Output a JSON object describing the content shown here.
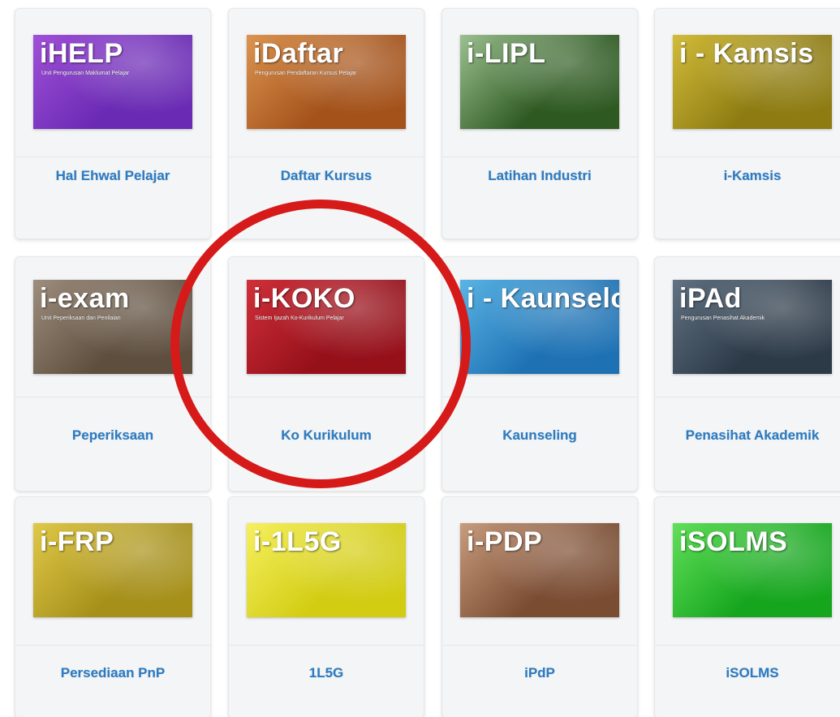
{
  "tiles": [
    {
      "label": "Hal Ehwal Pelajar",
      "image_title": "iHELP",
      "image_subtitle": "Unit Pengurusan Maklumat Pelajar",
      "color": "#6a2ab4",
      "color2": "#a050d8",
      "icon": "ihelp-logo-icon"
    },
    {
      "label": "Daftar Kursus",
      "image_title": "iDaftar",
      "image_subtitle": "Pengurusan Pendaftaran Kursus Pelajar",
      "color": "#a4521a",
      "color2": "#dc9450",
      "icon": "idaftar-logo-icon"
    },
    {
      "label": "Latihan Industri",
      "image_title": "i-LIPL",
      "image_subtitle": "",
      "color": "#2e5a22",
      "color2": "#9cc090",
      "icon": "ilipl-logo-icon"
    },
    {
      "label": "i-Kamsis",
      "image_title": "i - Kamsis",
      "image_subtitle": "",
      "color": "#8e7c12",
      "color2": "#d2bc3a",
      "icon": "ikamsis-logo-icon"
    },
    {
      "label": "Peperiksaan",
      "image_title": "i-exam",
      "image_subtitle": "Unit Peperiksaan dan Penilaian",
      "color": "#5e4e3e",
      "color2": "#9e8e7e",
      "icon": "iexam-logo-icon"
    },
    {
      "label": "Ko Kurikulum",
      "image_title": "i-KOKO",
      "image_subtitle": "Sistem Ijazah Ko-Kurikulum Pelajar",
      "color": "#96101a",
      "color2": "#d0303a",
      "icon": "ikoko-logo-icon"
    },
    {
      "label": "Kaunseling",
      "image_title": "i - Kaunselor",
      "image_subtitle": "",
      "color": "#1e72b4",
      "color2": "#5ab4e4",
      "icon": "ikaunselor-logo-icon"
    },
    {
      "label": "Penasihat Akademik",
      "image_title": "iPAd",
      "image_subtitle": "Pengurusan Penasihat Akademik",
      "color": "#2c3a48",
      "color2": "#627282",
      "icon": "ipad-logo-icon"
    },
    {
      "label": "Persediaan PnP",
      "image_title": "i-FRP",
      "image_subtitle": "",
      "color": "#a6901a",
      "color2": "#e0c848",
      "icon": "ifrp-logo-icon"
    },
    {
      "label": "1L5G",
      "image_title": "i-1L5G",
      "image_subtitle": "",
      "color": "#d2cc12",
      "color2": "#f6f060",
      "icon": "i1l5g-logo-icon"
    },
    {
      "label": "iPdP",
      "image_title": "i-PDP",
      "image_subtitle": "",
      "color": "#7a4c32",
      "color2": "#c89c7e",
      "icon": "ipdp-logo-icon"
    },
    {
      "label": "iSOLMS",
      "image_title": "iSOLMS",
      "image_subtitle": "",
      "color": "#16a61e",
      "color2": "#62e05a",
      "icon": "isolms-logo-icon"
    }
  ],
  "highlight": {
    "target": "Ko Kurikulum",
    "color": "#d61a1a"
  }
}
